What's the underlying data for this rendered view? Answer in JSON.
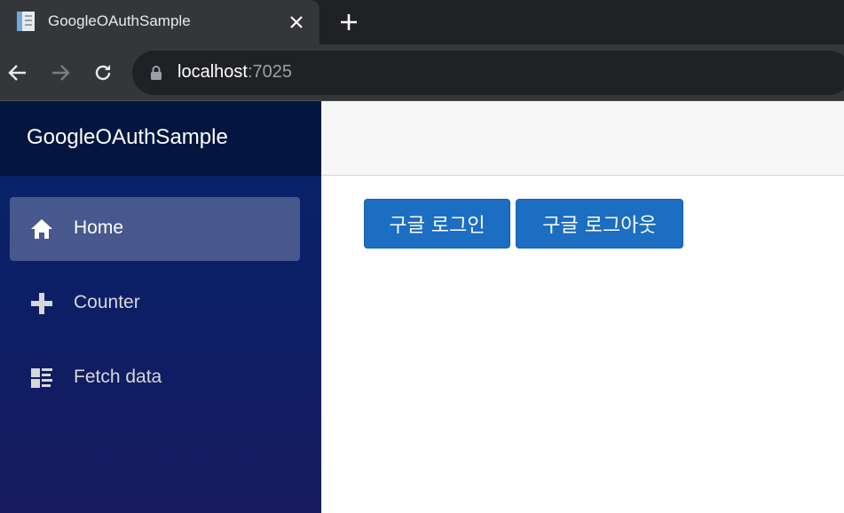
{
  "browser": {
    "tab_title": "GoogleOAuthSample",
    "url_host": "localhost",
    "url_port": ":7025",
    "icons": {
      "favicon": "document-icon",
      "close": "close-icon",
      "new_tab": "plus-icon",
      "back": "arrow-left-icon",
      "forward": "arrow-right-icon",
      "reload": "reload-icon",
      "secure": "lock-icon"
    }
  },
  "sidebar": {
    "brand": "GoogleOAuthSample",
    "items": [
      {
        "label": "Home",
        "icon": "home-icon",
        "active": true
      },
      {
        "label": "Counter",
        "icon": "plus-icon",
        "active": false
      },
      {
        "label": "Fetch data",
        "icon": "list-icon",
        "active": false
      }
    ]
  },
  "main": {
    "login_label": "구글 로그인",
    "logout_label": "구글 로그아웃"
  },
  "colors": {
    "primary_button": "#1b6ec2",
    "sidebar_top": "#06256b",
    "sidebar_bottom": "#171a5e",
    "tab_bg": "#35363a",
    "tabbar_bg": "#202124"
  }
}
